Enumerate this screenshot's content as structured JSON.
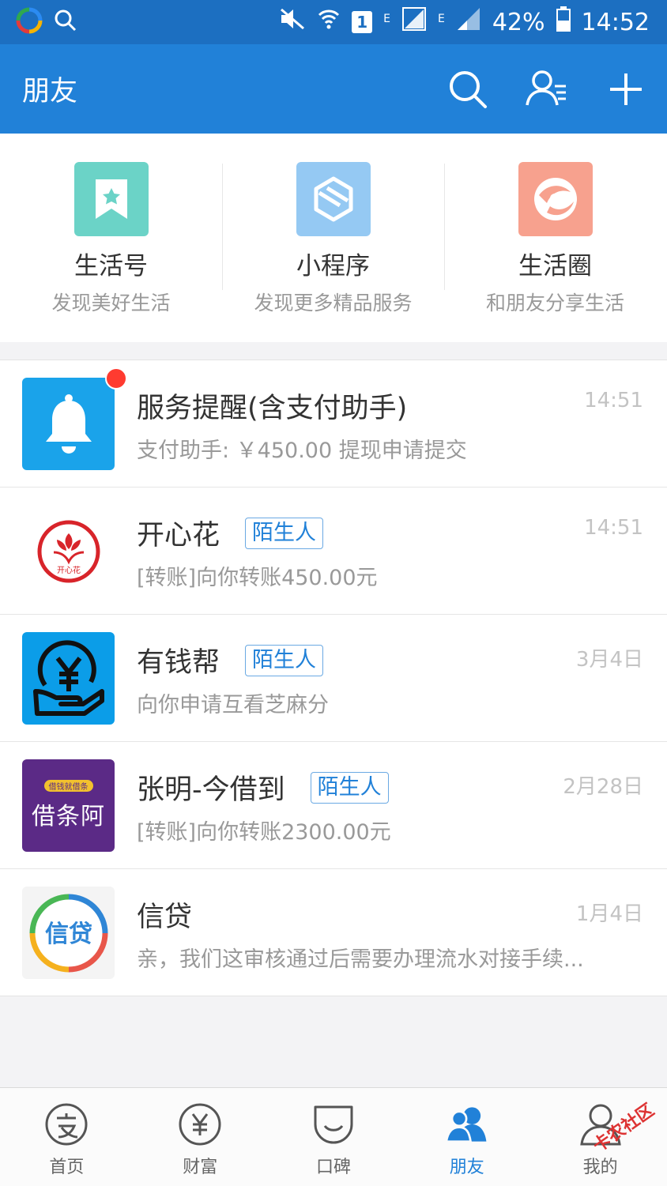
{
  "status_bar": {
    "battery": "42%",
    "time": "14:52",
    "network_label_1": "E",
    "network_label_2": "E",
    "sim": "1"
  },
  "header": {
    "title": "朋友",
    "icons": [
      "search-icon",
      "contacts-icon",
      "add-icon"
    ]
  },
  "features": [
    {
      "title": "生活号",
      "subtitle": "发现美好生活",
      "icon": "bookmark-star-icon",
      "color": "#6bd3c7"
    },
    {
      "title": "小程序",
      "subtitle": "发现更多精品服务",
      "icon": "mini-program-icon",
      "color": "#95c9f3"
    },
    {
      "title": "生活圈",
      "subtitle": "和朋友分享生活",
      "icon": "life-circle-icon",
      "color": "#f7a18e"
    }
  ],
  "messages": [
    {
      "name": "服务提醒(含支付助手)",
      "tag": "",
      "time": "14:51",
      "preview": "支付助手: ￥450.00 提现申请提交",
      "avatar_icon": "bell-icon"
    },
    {
      "name": "开心花",
      "tag": "陌生人",
      "time": "14:51",
      "preview": "[转账]向你转账450.00元",
      "avatar_icon": "flower-logo-icon",
      "avatar_text": "开心花"
    },
    {
      "name": "有钱帮",
      "tag": "陌生人",
      "time": "3月4日",
      "preview": "向你申请互看芝麻分",
      "avatar_icon": "yen-hand-icon"
    },
    {
      "name": "张明-今借到",
      "tag": "陌生人",
      "time": "2月28日",
      "preview": "[转账]向你转账2300.00元",
      "avatar_icon": "jietiao-logo-icon",
      "avatar_text": "借条阿",
      "avatar_small_text": "借钱就借条"
    },
    {
      "name": "信贷",
      "tag": "",
      "time": "1月4日",
      "preview": "亲，我们这审核通过后需要办理流水对接手续...",
      "avatar_icon": "xindai-logo-icon",
      "avatar_text": "信贷"
    }
  ],
  "tabs": [
    {
      "label": "首页",
      "icon": "alipay-home-icon",
      "active": false
    },
    {
      "label": "财富",
      "icon": "yen-circle-icon",
      "active": false
    },
    {
      "label": "口碑",
      "icon": "koubei-icon",
      "active": false
    },
    {
      "label": "朋友",
      "icon": "friends-icon",
      "active": true
    },
    {
      "label": "我的",
      "icon": "profile-icon",
      "active": false
    }
  ],
  "watermark": "卡农社区",
  "colors": {
    "status_bar": "#1c6fc1",
    "header": "#2181d8",
    "accent": "#2181d8",
    "unread_dot": "#ff3b30"
  }
}
